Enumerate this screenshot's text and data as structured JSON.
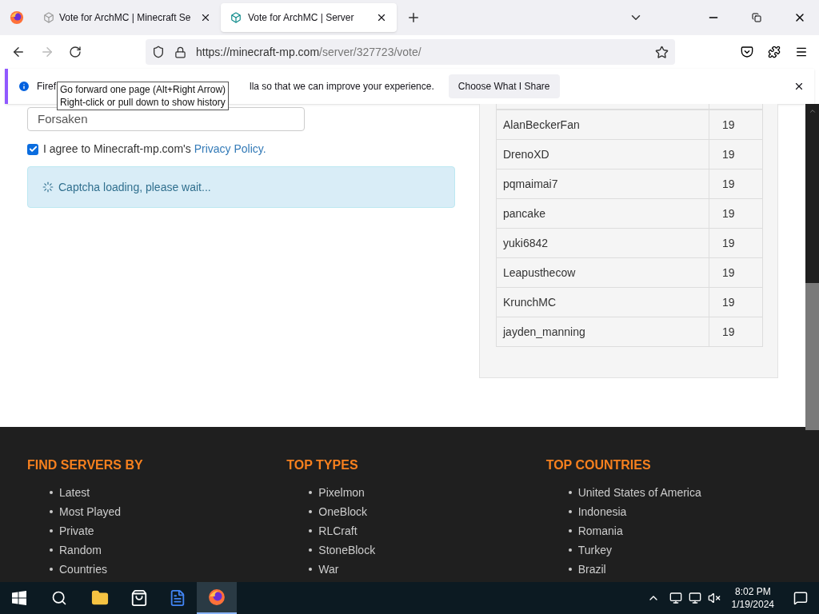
{
  "tabs": [
    {
      "title": "Vote for ArchMC | Minecraft Se",
      "selected": false
    },
    {
      "title": "Vote for ArchMC | Server",
      "selected": true
    }
  ],
  "address": {
    "host": "https://minecraft-mp.com",
    "path": "/server/327723/vote/"
  },
  "notification": {
    "start": "Firef",
    "end": "lla so that we can improve your experience.",
    "button": "Choose What I Share"
  },
  "tooltip": [
    "Go forward one page (Alt+Right Arrow)",
    "Right-click or pull down to show history"
  ],
  "form": {
    "username": "Forsaken",
    "agree": {
      "checked": true,
      "text": "I agree to Minecraft-mp.com's ",
      "link": "Privacy Policy."
    },
    "captcha": "Captcha loading, please wait..."
  },
  "voters": [
    {
      "name": "AlanBeckerFan",
      "votes": "19"
    },
    {
      "name": "DrenoXD",
      "votes": "19"
    },
    {
      "name": "pqmaimai7",
      "votes": "19"
    },
    {
      "name": "pancake",
      "votes": "19"
    },
    {
      "name": "yuki6842",
      "votes": "19"
    },
    {
      "name": "Leapusthecow",
      "votes": "19"
    },
    {
      "name": "KrunchMC",
      "votes": "19"
    },
    {
      "name": "jayden_manning",
      "votes": "19"
    }
  ],
  "footer": [
    {
      "heading": "FIND SERVERS BY",
      "links": [
        "Latest",
        "Most Played",
        "Private",
        "Random",
        "Countries"
      ]
    },
    {
      "heading": "TOP TYPES",
      "links": [
        "Pixelmon",
        "OneBlock",
        "RLCraft",
        "StoneBlock",
        "War"
      ]
    },
    {
      "heading": "TOP COUNTRIES",
      "links": [
        "United States of America",
        "Indonesia",
        "Romania",
        "Turkey",
        "Brazil"
      ]
    }
  ],
  "taskbar": {
    "time": "8:02 PM",
    "date": "1/19/2024"
  }
}
